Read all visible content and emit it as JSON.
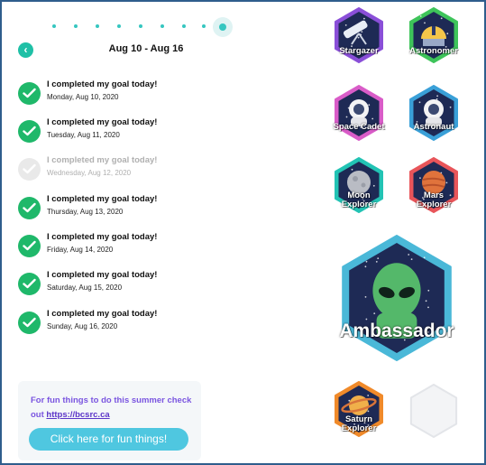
{
  "calendar": {
    "week_title": "Aug 10 - Aug 16",
    "entries": [
      {
        "title": "I completed my goal today!",
        "date": "Monday, Aug 10, 2020",
        "done": true
      },
      {
        "title": "I completed my goal today!",
        "date": "Tuesday, Aug 11, 2020",
        "done": true
      },
      {
        "title": "I completed my goal today!",
        "date": "Wednesday, Aug 12, 2020",
        "done": false
      },
      {
        "title": "I completed my goal today!",
        "date": "Thursday, Aug 13, 2020",
        "done": true
      },
      {
        "title": "I completed my goal today!",
        "date": "Friday, Aug 14, 2020",
        "done": true
      },
      {
        "title": "I completed my goal today!",
        "date": "Saturday, Aug 15, 2020",
        "done": true
      },
      {
        "title": "I completed my goal today!",
        "date": "Sunday, Aug 16, 2020",
        "done": true
      }
    ]
  },
  "promo": {
    "text": "For fun things to do this summer check out",
    "link": "https://bcsrc.ca",
    "button_label": "Click here for fun things!"
  },
  "badges": [
    {
      "label": "Stargazer",
      "border": "#8a4fd8",
      "icon": "telescope-icon"
    },
    {
      "label": "Astronomer",
      "border": "#3ec45a",
      "icon": "observatory-icon"
    },
    {
      "label": "Space Cadet",
      "border": "#d95cc8",
      "icon": "astronaut-helmet-icon"
    },
    {
      "label": "Astronaut",
      "border": "#3aa0d8",
      "icon": "astronaut-icon"
    },
    {
      "label": "Moon Explorer",
      "border": "#22c3b4",
      "icon": "moon-icon"
    },
    {
      "label": "Mars Explorer",
      "border": "#e8555a",
      "icon": "mars-icon"
    },
    {
      "label": "Ambassador",
      "border": "#4ab8d8",
      "icon": "alien-icon"
    },
    {
      "label": "Saturn Explorer",
      "border": "#f08a2a",
      "icon": "saturn-icon"
    }
  ],
  "colors": {
    "accent": "#1fc0a6",
    "check_done": "#1fb86a",
    "promo_text": "#7a55e0",
    "promo_button": "#4fc7e0"
  }
}
